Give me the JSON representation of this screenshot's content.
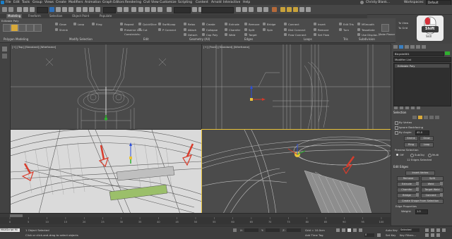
{
  "menu": [
    "File",
    "Edit",
    "Tools",
    "Group",
    "Views",
    "Create",
    "Modifiers",
    "Animation",
    "Graph Editors",
    "Rendering",
    "Civil View",
    "Customize",
    "Scripting",
    "Content",
    "Arnold",
    "Interactive",
    "Help"
  ],
  "user": "Christy  Blank...",
  "workspace_label": "Workspaces:",
  "workspace_value": "Default",
  "ribbon_tabs": [
    "Modeling",
    "Freeform",
    "Selection",
    "Object Paint",
    "Populate"
  ],
  "ribbon": {
    "left_mode": "Editable Poly",
    "poly_modeling_label": "Polygon Modeling",
    "modify_selection_label": "Modify Selection",
    "edit_label": "Edit",
    "geometry_label": "Geometry (All)",
    "edges_label": "Edges",
    "loops_label": "Loops",
    "tris_label": "Tris",
    "subdivision_label": "Subdivision",
    "grow": "Grow",
    "shrink": "Shrink",
    "loop": "Loop",
    "ring": "Ring",
    "repeat": "Repeat",
    "quickslice": "QuickSlice",
    "swiftloop": "SwiftLoop",
    "preserve_uvs": "Preserve UVs",
    "cut": "Cut",
    "pconnect": "P Connect",
    "constraints": "Constraints:",
    "relax": "Relax",
    "attach": "Attach",
    "detach": "Detach",
    "create": "Create",
    "collapse": "Collapse",
    "cap_poly": "Cap Poly",
    "extrude": "Extrude",
    "chamfer": "Chamfer",
    "weld": "Weld",
    "remove": "Remove",
    "split": "Split",
    "target": "Target",
    "bridge": "Bridge",
    "spin": "Spin",
    "connect": "Connect",
    "dist_connect": "Dist Connect",
    "flow_connect": "Flow Connect",
    "insert": "Insert",
    "remove2": "Remove",
    "set_flow": "Set Flow",
    "edit_tris": "Edit Tris",
    "turn": "Turn",
    "msmooth": "MSmooth",
    "tessellate": "Tessellate",
    "use_displace": "Use Displac...",
    "make_planar": "Make Planar",
    "to_view": "To View",
    "to_grid": "To Grid"
  },
  "skill_badge": {
    "label": "Shift",
    "sub": "Skill"
  },
  "viewports": {
    "top": "[+] [Top] [Standard] [Wireframe]",
    "front": "[+] [Front] [Standard] [Wireframe]",
    "left": "[+] [Left] [Standard] [Edged Faces]",
    "persp": "[+] [Perspective] [Standard] [Edged Faces]"
  },
  "command_panel": {
    "object_name": "Bicycle001",
    "modifier_list": "Modifier List",
    "stack_item": "Editable Poly",
    "selection_head": "Selection",
    "by_vertex": "By Vertex",
    "ignore_backfacing": "Ignore Backfacing",
    "by_angle": "By Angle:",
    "angle_value": "45.0",
    "shrink": "Shrink",
    "grow": "Grow",
    "ring": "Ring",
    "loop": "Loop",
    "preview_selection": "Preview Selection",
    "off": "Off",
    "subobj": "SubObj",
    "multi": "Multi",
    "selected_count": "12 Edges Selected",
    "edit_edges_head": "Edit Edges",
    "insert_vertex": "Insert Vertex",
    "remove": "Remove",
    "split": "Split",
    "extrude": "Extrude",
    "weld": "Weld",
    "chamfer": "Chamfer",
    "target_weld": "Target Weld",
    "bridge": "Bridge",
    "connect": "Connect",
    "create_shape": "Create Shape From Selection",
    "edge_properties": "Edge Properties",
    "weight_label": "Weight:",
    "weight_value": "1.0"
  },
  "status": {
    "script_field": "MAXScript Mi",
    "objects_selected": "1 Object Selected",
    "prompt": "Click or click-and-drag to select objects",
    "x_label": "X:",
    "y_label": "Y:",
    "z_label": "Z:",
    "grid": "Grid = 10.0cm",
    "add_time_tag": "Add Time Tag",
    "auto_key": "Auto Key",
    "selected": "Selected",
    "set_key": "Set Key",
    "key_filters": "Key Filters...",
    "frame": "0",
    "timeline_ticks": [
      "0",
      "5",
      "10",
      "15",
      "20",
      "25",
      "30",
      "35",
      "40",
      "45",
      "50",
      "55",
      "60",
      "65",
      "70",
      "75",
      "80",
      "85",
      "90",
      "95",
      "100"
    ]
  },
  "colors": {
    "axis_red": "#d03a2a",
    "axis_green": "#2fb02f",
    "axis_blue": "#2c4fd8",
    "annotation_red": "#d83c2c",
    "highlight_border": "#e8c23a",
    "viewport_dark": "#4b4b4b",
    "viewport_light": "#d8d8d8"
  }
}
